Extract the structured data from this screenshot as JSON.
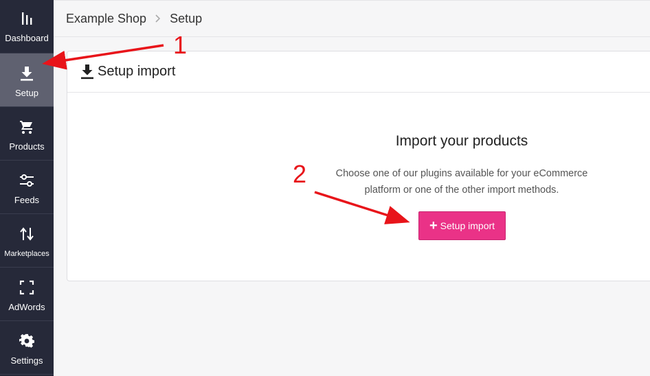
{
  "sidebar": {
    "items": [
      {
        "label": "Dashboard",
        "icon": "bar-chart-icon"
      },
      {
        "label": "Setup",
        "icon": "download-icon"
      },
      {
        "label": "Products",
        "icon": "cart-icon"
      },
      {
        "label": "Feeds",
        "icon": "sliders-icon"
      },
      {
        "label": "Marketplaces",
        "icon": "swap-vertical-icon"
      },
      {
        "label": "AdWords",
        "icon": "fullscreen-corners-icon"
      },
      {
        "label": "Settings",
        "icon": "gear-icon"
      }
    ],
    "active_index": 1
  },
  "breadcrumb": {
    "shop": "Example Shop",
    "page": "Setup"
  },
  "card": {
    "title": "Setup import",
    "heading": "Import your products",
    "description": "Choose one of our plugins available for your eCommerce platform or one of the other import methods.",
    "button_label": "Setup import"
  },
  "annotations": {
    "step1": "1",
    "step2": "2"
  },
  "colors": {
    "sidebar_bg": "#262939",
    "sidebar_active": "#5f6170",
    "button": "#ea3287",
    "annotation": "#e8141a"
  }
}
